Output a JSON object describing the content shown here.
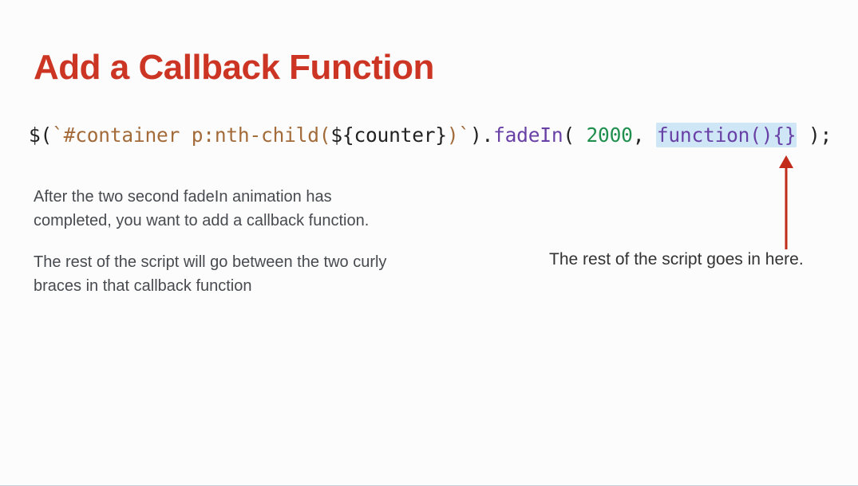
{
  "title": "Add a Callback Function",
  "code": {
    "t1": "$(",
    "t2": "`#container p:nth-child(",
    "t3": "${",
    "t4": "counter",
    "t5": "}",
    "t6": ")`",
    "t7": ").",
    "t8": "fadeIn",
    "t9": "( ",
    "t10": "2000",
    "t11": ", ",
    "t12": "function(){}",
    "t13": " );"
  },
  "left": {
    "p1": "After the two second fadeIn animation has completed, you want to add a callback function.",
    "p2": "The rest of the script will go between the two curly braces in that callback function"
  },
  "annotation": "The rest of the script goes in here.",
  "colors": {
    "title": "#cc3524",
    "highlight_bg": "#cfe6f7",
    "arrow": "#c22b1a"
  }
}
